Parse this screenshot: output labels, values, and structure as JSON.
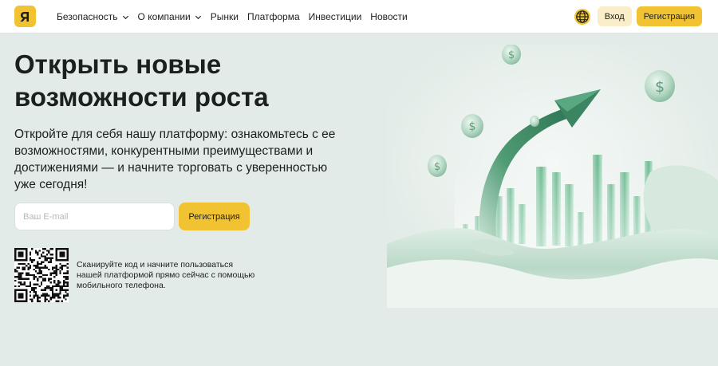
{
  "header": {
    "nav": [
      {
        "label": "Безопасность",
        "has_dropdown": true
      },
      {
        "label": "О компании",
        "has_dropdown": true
      },
      {
        "label": "Рынки",
        "has_dropdown": false
      },
      {
        "label": "Платформа",
        "has_dropdown": false
      },
      {
        "label": "Инвестиции",
        "has_dropdown": false
      },
      {
        "label": "Новости",
        "has_dropdown": false
      }
    ],
    "login_label": "Вход",
    "register_label": "Регистрация",
    "globe_icon": "globe-icon",
    "logo_icon": "brand-logo-icon"
  },
  "hero": {
    "title": "Открыть новые возможности роста",
    "subtitle": "Откройте для себя нашу платформу: ознакомьтесь с ее возможностями, конкурентными преимуществами и достижениями — и начните торговать с уверенностью уже сегодня!",
    "email_placeholder": "Ваш E-mail",
    "email_value": "",
    "register_label": "Регистрация"
  },
  "qr": {
    "text": "Сканируйте код и начните пользоваться нашей платформой прямо сейчас с помощью мобильного телефона."
  },
  "colors": {
    "accent": "#f1c232",
    "accent_light": "#faeec9",
    "background": "#e2ebe7",
    "text": "#1b1f1d",
    "green": "#5fae86"
  }
}
